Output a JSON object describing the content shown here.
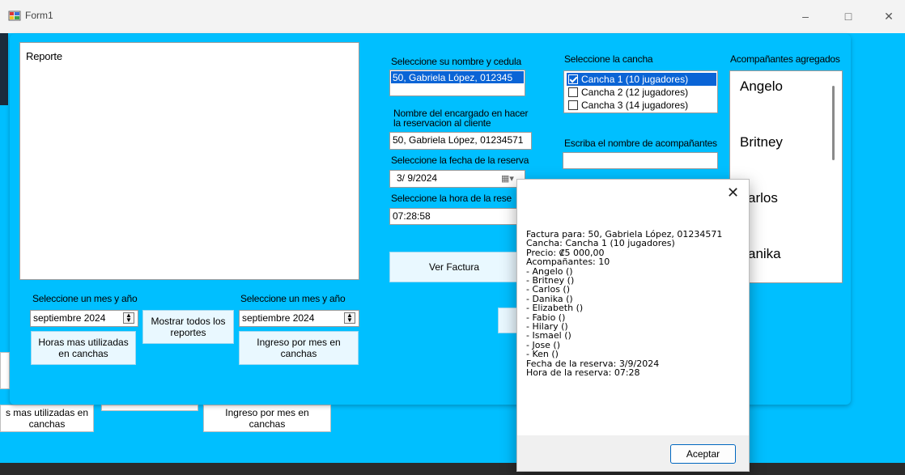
{
  "window": {
    "title": "Form1"
  },
  "background_buttons": {
    "horas_label": "s mas utilizadas en\ncanchas",
    "ingreso_label": "Ingreso por mes en\ncanchas"
  },
  "report": {
    "label": "Reporte"
  },
  "left_controls": {
    "month_label_1": "Seleccione un mes y año",
    "month_value_1": "septiembre 2024",
    "horas_button": "Horas mas utilizadas\nen canchas",
    "mostrar_button": "Mostrar todos los\nreportes",
    "month_label_2": "Seleccione un mes y año",
    "month_value_2": "septiembre 2024",
    "ingreso_button": "Ingreso por mes en\ncanchas"
  },
  "reserva": {
    "nombre_label": "Seleccione su nombre y cedula",
    "nombre_value": "50, Gabriela López, 012345",
    "encargado_label": "Nombre del encargado en hacer\nla reservacion al cliente",
    "encargado_value": "50, Gabriela López, 01234571",
    "fecha_label": "Seleccione la fecha de la reserva",
    "fecha_value": "3/ 9/2024",
    "hora_label": "Seleccione la hora de la rese",
    "hora_value": "07:28:58",
    "ver_factura": "Ver Factura"
  },
  "cancha": {
    "label": "Seleccione la cancha",
    "options": [
      {
        "label": "Cancha 1 (10 jugadores)",
        "checked": true,
        "selected": true
      },
      {
        "label": "Cancha 2 (12 jugadores)",
        "checked": false,
        "selected": false
      },
      {
        "label": "Cancha 3 (14 jugadores)",
        "checked": false,
        "selected": false
      }
    ],
    "acomp_input_label": "Escriba el nombre de  acompañantes",
    "acomp_input_value": ""
  },
  "acompanantes": {
    "label": "Acompañantes agregados",
    "items": [
      "Angelo",
      "Britney",
      "arlos",
      "anika"
    ]
  },
  "dialog": {
    "lines": [
      "Factura para: 50, Gabriela López, 01234571",
      "Cancha: Cancha 1 (10 jugadores)",
      "Precio: ₡5 000,00",
      "Acompañantes: 10",
      " - Angelo ()",
      " - Britney ()",
      " - Carlos ()",
      " - Danika ()",
      " - Elizabeth ()",
      " - Fabio ()",
      " - Hilary ()",
      " - Ismael ()",
      " - Jose ()",
      " - Ken ()",
      "Fecha de la reserva: 3/9/2024",
      "Hora de la reserva: 07:28"
    ],
    "ok_button": "Aceptar"
  }
}
